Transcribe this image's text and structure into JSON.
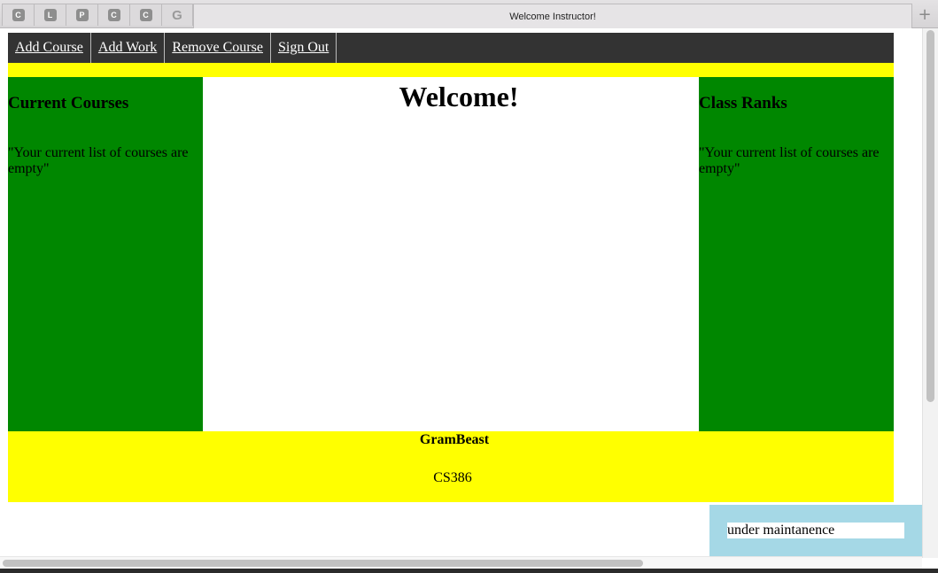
{
  "browser": {
    "pinned_tabs": [
      {
        "icon": "c-favicon-icon",
        "glyph": "C"
      },
      {
        "icon": "l-favicon-icon",
        "glyph": "L"
      },
      {
        "icon": "p-favicon-icon",
        "glyph": "P"
      },
      {
        "icon": "c-favicon-icon",
        "glyph": "C"
      },
      {
        "icon": "c-favicon-icon",
        "glyph": "C"
      },
      {
        "icon": "google-favicon-icon",
        "glyph": "G"
      }
    ],
    "active_tab_title": "Welcome Instructor!",
    "new_tab_glyph": "+"
  },
  "nav": {
    "items": [
      "Add Course",
      "Add Work",
      "Remove Course",
      "Sign Out"
    ]
  },
  "left_panel": {
    "heading": "Current Courses",
    "text": "\"Your current list of courses are empty\""
  },
  "center_panel": {
    "heading": "Welcome!"
  },
  "right_panel": {
    "heading": "Class Ranks",
    "text": "\"Your current list of courses are empty\""
  },
  "footer": {
    "brand": "GramBeast",
    "course": "CS386"
  },
  "notice": {
    "text": "under maintanence"
  },
  "colors": {
    "nav_bg": "#333333",
    "panel_green": "#008700",
    "accent_yellow": "#ffff00",
    "notice_blue": "#a5d8e6"
  }
}
